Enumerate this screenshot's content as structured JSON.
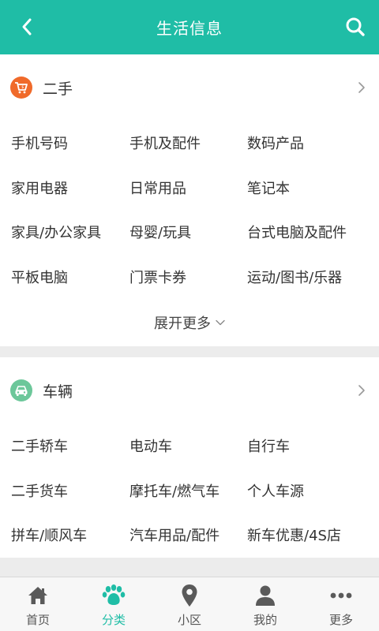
{
  "header": {
    "title": "生活信息",
    "back_icon": "chevron-left-icon",
    "search_icon": "search-icon"
  },
  "colors": {
    "brand": "#1fbda6",
    "secondhand_icon": "#f06a2a",
    "vehicle_icon": "#6cc79a",
    "inactive_tab": "#555555"
  },
  "sections": [
    {
      "title": "二手",
      "icon": "shopping-cart-icon",
      "items": [
        "手机号码",
        "手机及配件",
        "数码产品",
        "家用电器",
        "日常用品",
        "笔记本",
        "家具/办公家具",
        "母婴/玩具",
        "台式电脑及配件",
        "平板电脑",
        "门票卡券",
        "运动/图书/乐器"
      ],
      "expand_label": "展开更多"
    },
    {
      "title": "车辆",
      "icon": "car-icon",
      "items": [
        "二手轿车",
        "电动车",
        "自行车",
        "二手货车",
        "摩托车/燃气车",
        "个人车源",
        "拼车/顺风车",
        "汽车用品/配件",
        "新车优惠/4S店"
      ]
    }
  ],
  "tabs": [
    {
      "label": "首页",
      "icon": "home-icon",
      "active": false
    },
    {
      "label": "分类",
      "icon": "paw-icon",
      "active": true
    },
    {
      "label": "小区",
      "icon": "location-pin-icon",
      "active": false
    },
    {
      "label": "我的",
      "icon": "user-icon",
      "active": false
    },
    {
      "label": "更多",
      "icon": "more-dots-icon",
      "active": false
    }
  ]
}
